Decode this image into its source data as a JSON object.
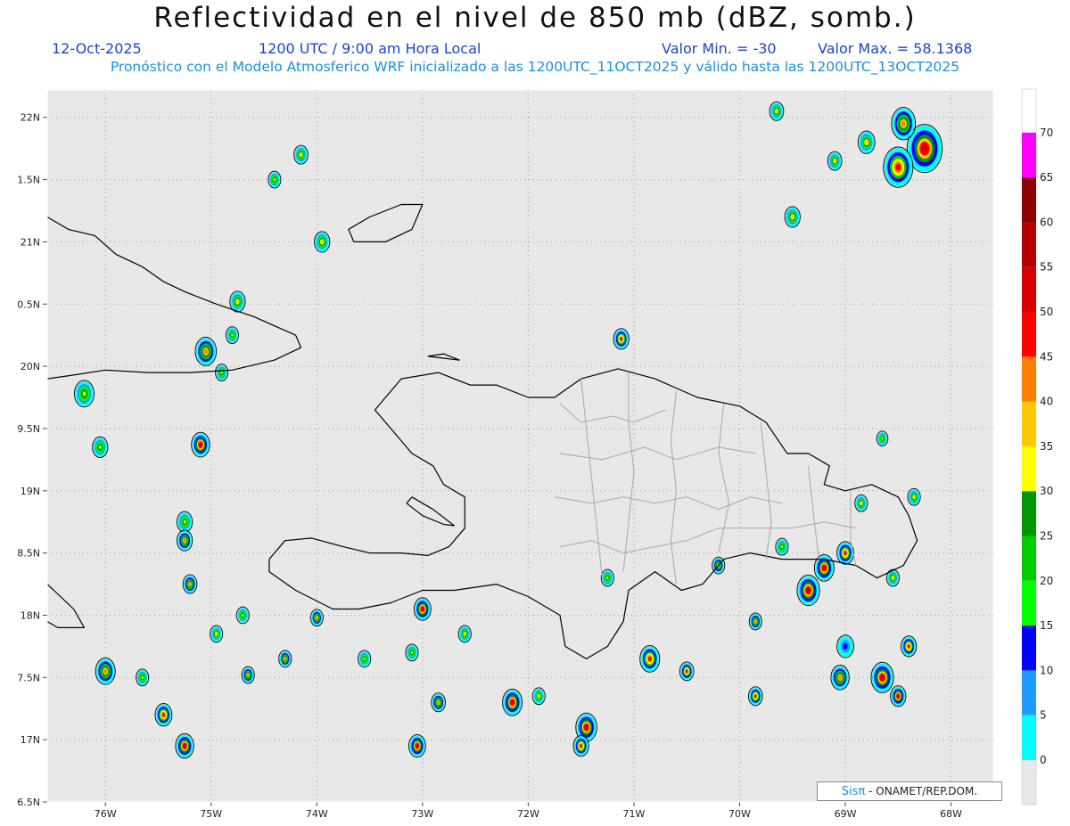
{
  "title": "Reflectividad en el nivel de 850 mb (dBZ, somb.)",
  "date": "12-Oct-2025",
  "time": "1200 UTC / 9:00 am Hora Local",
  "valor_min": "Valor Min. = -30",
  "valor_max": "Valor Max. = 58.1368",
  "forecast_note": "Pronóstico con el Modelo Atmosferico WRF inicializado a las 1200UTC_11OCT2025 y válido hasta las 1200UTC_13OCT2025",
  "credit": {
    "brand": "Sisπ",
    "text": "- ONAMET/REP.DOM."
  },
  "map": {
    "lon_range": [
      -76.55,
      -67.6
    ],
    "lat_range": [
      16.5,
      22.22
    ],
    "lon_ticks": [
      {
        "value": -76,
        "label": "76W"
      },
      {
        "value": -75,
        "label": "75W"
      },
      {
        "value": -74,
        "label": "74W"
      },
      {
        "value": -73,
        "label": "73W"
      },
      {
        "value": -72,
        "label": "72W"
      },
      {
        "value": -71,
        "label": "71W"
      },
      {
        "value": -70,
        "label": "70W"
      },
      {
        "value": -69,
        "label": "69W"
      },
      {
        "value": -68,
        "label": "68W"
      }
    ],
    "lat_ticks": [
      {
        "value": 22,
        "label": "22N"
      },
      {
        "value": 21.5,
        "label": "1.5N"
      },
      {
        "value": 21,
        "label": "21N"
      },
      {
        "value": 20.5,
        "label": "0.5N"
      },
      {
        "value": 20,
        "label": "20N"
      },
      {
        "value": 19.5,
        "label": "9.5N"
      },
      {
        "value": 19,
        "label": "19N"
      },
      {
        "value": 18.5,
        "label": "8.5N"
      },
      {
        "value": 18,
        "label": "18N"
      },
      {
        "value": 17.5,
        "label": "7.5N"
      },
      {
        "value": 17,
        "label": "17N"
      },
      {
        "value": 16.5,
        "label": "6.5N"
      }
    ],
    "gridlines": "dotted",
    "background_color": "#e8e8e8",
    "coastline_color": "#000000",
    "province_border_color": "#a8a8a8"
  },
  "colorbar": {
    "levels": [
      0,
      5,
      10,
      15,
      20,
      25,
      30,
      35,
      40,
      45,
      50,
      55,
      60,
      65,
      70
    ],
    "colors": [
      "#00ffff",
      "#1e9bff",
      "#0000ff",
      "#00ff00",
      "#00cc00",
      "#009600",
      "#ffff00",
      "#ffc800",
      "#ff8000",
      "#ff0000",
      "#d60000",
      "#b40000",
      "#8b0000",
      "#ff00ff",
      "#9600ff"
    ],
    "below_color": "#e8e8e8"
  },
  "cells": [
    {
      "lon": -68.25,
      "lat": 21.75,
      "size": 1.0,
      "max": 50
    },
    {
      "lon": -68.5,
      "lat": 21.6,
      "size": 0.8,
      "max": 45
    },
    {
      "lon": -68.45,
      "lat": 21.95,
      "size": 0.6,
      "max": 40
    },
    {
      "lon": -68.8,
      "lat": 21.8,
      "size": 0.35,
      "max": 35
    },
    {
      "lon": -69.65,
      "lat": 22.05,
      "size": 0.25,
      "max": 35
    },
    {
      "lon": -69.5,
      "lat": 21.2,
      "size": 0.3,
      "max": 35
    },
    {
      "lon": -69.1,
      "lat": 21.65,
      "size": 0.25,
      "max": 35
    },
    {
      "lon": -74.15,
      "lat": 21.7,
      "size": 0.25,
      "max": 35
    },
    {
      "lon": -74.4,
      "lat": 21.5,
      "size": 0.2,
      "max": 30
    },
    {
      "lon": -73.95,
      "lat": 21.0,
      "size": 0.3,
      "max": 35
    },
    {
      "lon": -74.75,
      "lat": 20.52,
      "size": 0.3,
      "max": 35
    },
    {
      "lon": -75.05,
      "lat": 20.12,
      "size": 0.5,
      "max": 40
    },
    {
      "lon": -74.8,
      "lat": 20.25,
      "size": 0.2,
      "max": 30
    },
    {
      "lon": -76.2,
      "lat": 19.78,
      "size": 0.45,
      "max": 30
    },
    {
      "lon": -76.05,
      "lat": 19.35,
      "size": 0.3,
      "max": 30
    },
    {
      "lon": -75.1,
      "lat": 19.37,
      "size": 0.4,
      "max": 50
    },
    {
      "lon": -75.25,
      "lat": 18.75,
      "size": 0.3,
      "max": 30
    },
    {
      "lon": -75.25,
      "lat": 18.6,
      "size": 0.3,
      "max": 40
    },
    {
      "lon": -75.2,
      "lat": 18.25,
      "size": 0.25,
      "max": 40
    },
    {
      "lon": -71.12,
      "lat": 20.22,
      "size": 0.3,
      "max": 45
    },
    {
      "lon": -73.0,
      "lat": 18.05,
      "size": 0.35,
      "max": 50
    },
    {
      "lon": -74.0,
      "lat": 17.98,
      "size": 0.2,
      "max": 40
    },
    {
      "lon": -73.05,
      "lat": 16.95,
      "size": 0.35,
      "max": 50
    },
    {
      "lon": -72.85,
      "lat": 17.3,
      "size": 0.25,
      "max": 40
    },
    {
      "lon": -72.15,
      "lat": 17.3,
      "size": 0.45,
      "max": 50
    },
    {
      "lon": -71.45,
      "lat": 17.1,
      "size": 0.5,
      "max": 55
    },
    {
      "lon": -71.5,
      "lat": 16.95,
      "size": 0.3,
      "max": 45
    },
    {
      "lon": -70.85,
      "lat": 17.65,
      "size": 0.45,
      "max": 45
    },
    {
      "lon": -70.5,
      "lat": 17.55,
      "size": 0.25,
      "max": 45
    },
    {
      "lon": -76.0,
      "lat": 17.55,
      "size": 0.45,
      "max": 40
    },
    {
      "lon": -75.45,
      "lat": 17.2,
      "size": 0.35,
      "max": 45
    },
    {
      "lon": -75.25,
      "lat": 16.95,
      "size": 0.4,
      "max": 50
    },
    {
      "lon": -74.65,
      "lat": 17.52,
      "size": 0.2,
      "max": 40
    },
    {
      "lon": -74.3,
      "lat": 17.65,
      "size": 0.2,
      "max": 40
    },
    {
      "lon": -69.35,
      "lat": 18.2,
      "size": 0.55,
      "max": 55
    },
    {
      "lon": -69.2,
      "lat": 18.38,
      "size": 0.45,
      "max": 50
    },
    {
      "lon": -69.0,
      "lat": 18.5,
      "size": 0.35,
      "max": 45
    },
    {
      "lon": -69.0,
      "lat": 17.75,
      "size": 0.35,
      "max": 10
    },
    {
      "lon": -69.05,
      "lat": 17.5,
      "size": 0.4,
      "max": 40
    },
    {
      "lon": -68.65,
      "lat": 17.5,
      "size": 0.55,
      "max": 55
    },
    {
      "lon": -68.5,
      "lat": 17.35,
      "size": 0.3,
      "max": 50
    },
    {
      "lon": -68.4,
      "lat": 17.75,
      "size": 0.3,
      "max": 45
    },
    {
      "lon": -68.55,
      "lat": 18.3,
      "size": 0.2,
      "max": 35
    },
    {
      "lon": -68.35,
      "lat": 18.95,
      "size": 0.2,
      "max": 35
    },
    {
      "lon": -69.85,
      "lat": 17.35,
      "size": 0.25,
      "max": 45
    },
    {
      "lon": -70.2,
      "lat": 18.4,
      "size": 0.2,
      "max": 40
    },
    {
      "lon": -69.85,
      "lat": 17.95,
      "size": 0.2,
      "max": 40
    },
    {
      "lon": -71.25,
      "lat": 18.3,
      "size": 0.2,
      "max": 30
    },
    {
      "lon": -71.9,
      "lat": 17.35,
      "size": 0.2,
      "max": 35
    },
    {
      "lon": -72.6,
      "lat": 17.85,
      "size": 0.2,
      "max": 35
    },
    {
      "lon": -73.55,
      "lat": 17.65,
      "size": 0.2,
      "max": 30
    },
    {
      "lon": -74.95,
      "lat": 17.85,
      "size": 0.2,
      "max": 35
    },
    {
      "lon": -74.7,
      "lat": 18.0,
      "size": 0.2,
      "max": 30
    },
    {
      "lon": -75.65,
      "lat": 17.5,
      "size": 0.2,
      "max": 30
    },
    {
      "lon": -74.9,
      "lat": 19.95,
      "size": 0.2,
      "max": 30
    },
    {
      "lon": -69.6,
      "lat": 18.55,
      "size": 0.2,
      "max": 30
    },
    {
      "lon": -68.65,
      "lat": 19.42,
      "size": 0.15,
      "max": 30
    },
    {
      "lon": -68.85,
      "lat": 18.9,
      "size": 0.2,
      "max": 35
    },
    {
      "lon": -73.1,
      "lat": 17.7,
      "size": 0.2,
      "max": 30
    }
  ],
  "coastlines": {
    "hispaniola": [
      [
        -74.45,
        18.45
      ],
      [
        -74.3,
        18.6
      ],
      [
        -74.05,
        18.62
      ],
      [
        -73.75,
        18.55
      ],
      [
        -73.5,
        18.5
      ],
      [
        -73.2,
        18.5
      ],
      [
        -72.95,
        18.48
      ],
      [
        -72.75,
        18.55
      ],
      [
        -72.6,
        18.7
      ],
      [
        -72.6,
        18.95
      ],
      [
        -72.8,
        19.05
      ],
      [
        -72.9,
        19.2
      ],
      [
        -73.1,
        19.3
      ],
      [
        -73.45,
        19.65
      ],
      [
        -73.2,
        19.9
      ],
      [
        -72.85,
        19.95
      ],
      [
        -72.55,
        19.85
      ],
      [
        -72.3,
        19.85
      ],
      [
        -72.0,
        19.75
      ],
      [
        -71.75,
        19.75
      ],
      [
        -71.5,
        19.9
      ],
      [
        -71.15,
        19.98
      ],
      [
        -70.8,
        19.9
      ],
      [
        -70.4,
        19.75
      ],
      [
        -70.0,
        19.68
      ],
      [
        -69.75,
        19.55
      ],
      [
        -69.55,
        19.3
      ],
      [
        -69.35,
        19.3
      ],
      [
        -69.15,
        19.2
      ],
      [
        -69.2,
        19.05
      ],
      [
        -69.0,
        19.0
      ],
      [
        -68.75,
        19.05
      ],
      [
        -68.5,
        18.95
      ],
      [
        -68.4,
        18.8
      ],
      [
        -68.32,
        18.6
      ],
      [
        -68.45,
        18.4
      ],
      [
        -68.7,
        18.3
      ],
      [
        -68.9,
        18.4
      ],
      [
        -69.2,
        18.45
      ],
      [
        -69.6,
        18.45
      ],
      [
        -69.9,
        18.5
      ],
      [
        -70.15,
        18.45
      ],
      [
        -70.35,
        18.25
      ],
      [
        -70.55,
        18.2
      ],
      [
        -70.8,
        18.35
      ],
      [
        -71.05,
        18.2
      ],
      [
        -71.1,
        17.95
      ],
      [
        -71.25,
        17.75
      ],
      [
        -71.45,
        17.65
      ],
      [
        -71.65,
        17.75
      ],
      [
        -71.7,
        18.0
      ],
      [
        -72.0,
        18.15
      ],
      [
        -72.3,
        18.25
      ],
      [
        -72.7,
        18.2
      ],
      [
        -73.0,
        18.2
      ],
      [
        -73.3,
        18.1
      ],
      [
        -73.6,
        18.05
      ],
      [
        -73.85,
        18.05
      ],
      [
        -74.2,
        18.2
      ],
      [
        -74.45,
        18.35
      ],
      [
        -74.45,
        18.45
      ]
    ],
    "cuba": [
      [
        -76.55,
        21.2
      ],
      [
        -76.35,
        21.1
      ],
      [
        -76.1,
        21.05
      ],
      [
        -75.9,
        20.9
      ],
      [
        -75.65,
        20.8
      ],
      [
        -75.45,
        20.68
      ],
      [
        -75.25,
        20.6
      ],
      [
        -74.95,
        20.5
      ],
      [
        -74.6,
        20.4
      ],
      [
        -74.2,
        20.25
      ],
      [
        -74.15,
        20.15
      ],
      [
        -74.4,
        20.05
      ],
      [
        -74.8,
        19.97
      ],
      [
        -75.2,
        19.95
      ],
      [
        -75.6,
        19.95
      ],
      [
        -76.0,
        19.97
      ],
      [
        -76.3,
        19.93
      ],
      [
        -76.55,
        19.9
      ]
    ],
    "inagua": [
      [
        -73.65,
        21.0
      ],
      [
        -73.35,
        21.0
      ],
      [
        -73.1,
        21.1
      ],
      [
        -73.0,
        21.3
      ],
      [
        -73.2,
        21.3
      ],
      [
        -73.5,
        21.2
      ],
      [
        -73.7,
        21.1
      ],
      [
        -73.65,
        21.0
      ]
    ],
    "gonave": [
      [
        -73.1,
        18.95
      ],
      [
        -72.9,
        18.85
      ],
      [
        -72.7,
        18.72
      ],
      [
        -72.8,
        18.73
      ],
      [
        -73.0,
        18.8
      ],
      [
        -73.15,
        18.9
      ],
      [
        -73.1,
        18.95
      ]
    ],
    "tortuga": [
      [
        -72.95,
        20.08
      ],
      [
        -72.65,
        20.05
      ],
      [
        -72.8,
        20.1
      ],
      [
        -72.95,
        20.08
      ]
    ],
    "jamaica": [
      [
        -76.55,
        18.25
      ],
      [
        -76.3,
        18.05
      ],
      [
        -76.2,
        17.9
      ],
      [
        -76.45,
        17.9
      ],
      [
        -76.55,
        17.95
      ]
    ]
  },
  "provinces": [
    [
      [
        -71.7,
        19.7
      ],
      [
        -71.5,
        19.55
      ],
      [
        -71.2,
        19.6
      ],
      [
        -71.0,
        19.55
      ],
      [
        -70.7,
        19.65
      ]
    ],
    [
      [
        -71.7,
        19.3
      ],
      [
        -71.3,
        19.25
      ],
      [
        -70.9,
        19.35
      ],
      [
        -70.6,
        19.25
      ],
      [
        -70.2,
        19.35
      ],
      [
        -69.85,
        19.3
      ]
    ],
    [
      [
        -71.75,
        18.95
      ],
      [
        -71.4,
        18.9
      ],
      [
        -71.1,
        18.95
      ],
      [
        -70.8,
        18.9
      ],
      [
        -70.5,
        18.95
      ],
      [
        -70.2,
        18.85
      ],
      [
        -69.9,
        18.95
      ],
      [
        -69.6,
        18.9
      ]
    ],
    [
      [
        -71.7,
        18.55
      ],
      [
        -71.4,
        18.6
      ],
      [
        -71.1,
        18.5
      ],
      [
        -70.8,
        18.55
      ],
      [
        -70.5,
        18.6
      ],
      [
        -70.2,
        18.7
      ],
      [
        -69.9,
        18.7
      ],
      [
        -69.5,
        18.7
      ],
      [
        -69.2,
        18.75
      ],
      [
        -68.9,
        18.7
      ]
    ],
    [
      [
        -71.5,
        19.9
      ],
      [
        -71.45,
        19.5
      ],
      [
        -71.4,
        19.1
      ],
      [
        -71.35,
        18.7
      ],
      [
        -71.3,
        18.3
      ]
    ],
    [
      [
        -71.05,
        19.95
      ],
      [
        -71.05,
        19.55
      ],
      [
        -71.0,
        19.15
      ],
      [
        -71.05,
        18.75
      ],
      [
        -71.1,
        18.35
      ]
    ],
    [
      [
        -70.6,
        19.8
      ],
      [
        -70.65,
        19.4
      ],
      [
        -70.6,
        19.0
      ],
      [
        -70.65,
        18.6
      ],
      [
        -70.6,
        18.25
      ]
    ],
    [
      [
        -70.15,
        19.7
      ],
      [
        -70.2,
        19.3
      ],
      [
        -70.1,
        18.9
      ],
      [
        -70.2,
        18.5
      ]
    ],
    [
      [
        -69.8,
        19.55
      ],
      [
        -69.75,
        19.15
      ],
      [
        -69.7,
        18.75
      ],
      [
        -69.75,
        18.45
      ]
    ],
    [
      [
        -69.35,
        19.2
      ],
      [
        -69.3,
        18.8
      ],
      [
        -69.25,
        18.45
      ]
    ],
    [
      [
        -68.95,
        19.0
      ],
      [
        -68.95,
        18.6
      ],
      [
        -68.9,
        18.4
      ]
    ]
  ]
}
